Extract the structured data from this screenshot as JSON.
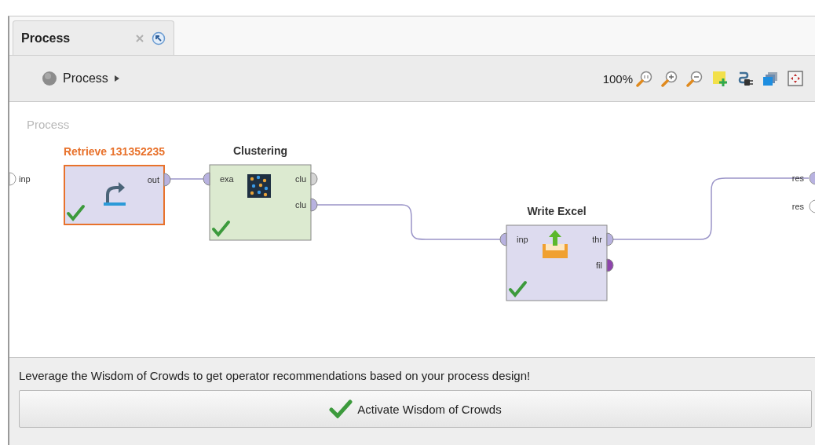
{
  "tabs": [
    {
      "label": "Process",
      "selected": true
    }
  ],
  "breadcrumb": {
    "label": "Process"
  },
  "toolbar": {
    "zoom": "100%"
  },
  "canvas": {
    "title": "Process",
    "process_inputs": [
      {
        "label": "inp",
        "color": "#ffffff"
      }
    ],
    "process_outputs": [
      {
        "label": "res",
        "color": "#b8b2e0"
      },
      {
        "label": "res",
        "color": "#ffffff"
      }
    ],
    "operators": [
      {
        "name": "Retrieve 131352235",
        "kind": "retrieve",
        "selected": true,
        "executed": true,
        "outputs": [
          {
            "label": "out",
            "color": "#b8b2e0"
          }
        ]
      },
      {
        "name": "Clustering",
        "kind": "clustering",
        "selected": false,
        "executed": true,
        "inputs": [
          {
            "label": "exa",
            "color": "#b8b2e0"
          }
        ],
        "outputs": [
          {
            "label": "clu",
            "color": "#d4d4d4"
          },
          {
            "label": "clu",
            "color": "#b8b2e0"
          }
        ]
      },
      {
        "name": "Write Excel",
        "kind": "write",
        "selected": false,
        "executed": true,
        "inputs": [
          {
            "label": "inp",
            "color": "#b8b2e0"
          }
        ],
        "outputs": [
          {
            "label": "thr",
            "color": "#b8b2e0"
          },
          {
            "label": "fil",
            "color": "#8e44ad"
          }
        ]
      }
    ]
  },
  "recommendation": {
    "text": "Leverage the Wisdom of Crowds to get operator recommendations based on your process design!",
    "button": "Activate Wisdom of Crowds"
  }
}
